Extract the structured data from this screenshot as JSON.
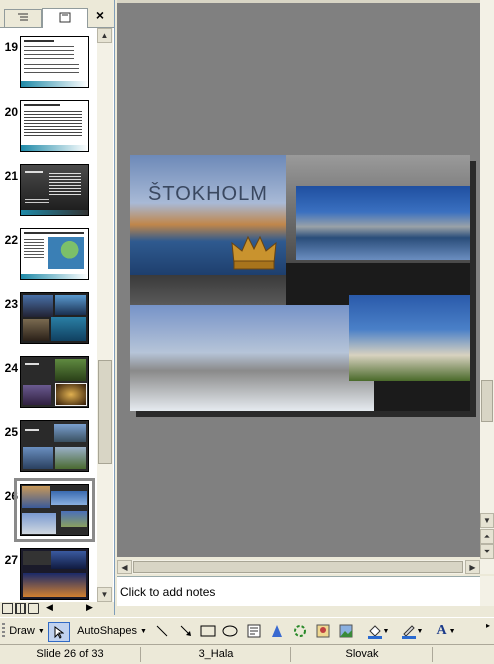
{
  "panel": {
    "close_glyph": "×",
    "slides": [
      {
        "num": "19"
      },
      {
        "num": "20"
      },
      {
        "num": "21"
      },
      {
        "num": "22"
      },
      {
        "num": "23"
      },
      {
        "num": "24"
      },
      {
        "num": "25"
      },
      {
        "num": "26"
      },
      {
        "num": "27"
      }
    ]
  },
  "slide": {
    "title": "ŠTOKHOLM"
  },
  "notes": {
    "placeholder": "Click to add notes"
  },
  "drawbar": {
    "draw_label": "Draw",
    "autoshapes_label": "AutoShapes",
    "font_color_glyph": "A"
  },
  "status": {
    "slide_position": "Slide 26 of 33",
    "design": "3_Hala",
    "language": "Slovak"
  },
  "colors": {
    "selected_outline": "#8a8a8a",
    "workspace": "#808080"
  }
}
